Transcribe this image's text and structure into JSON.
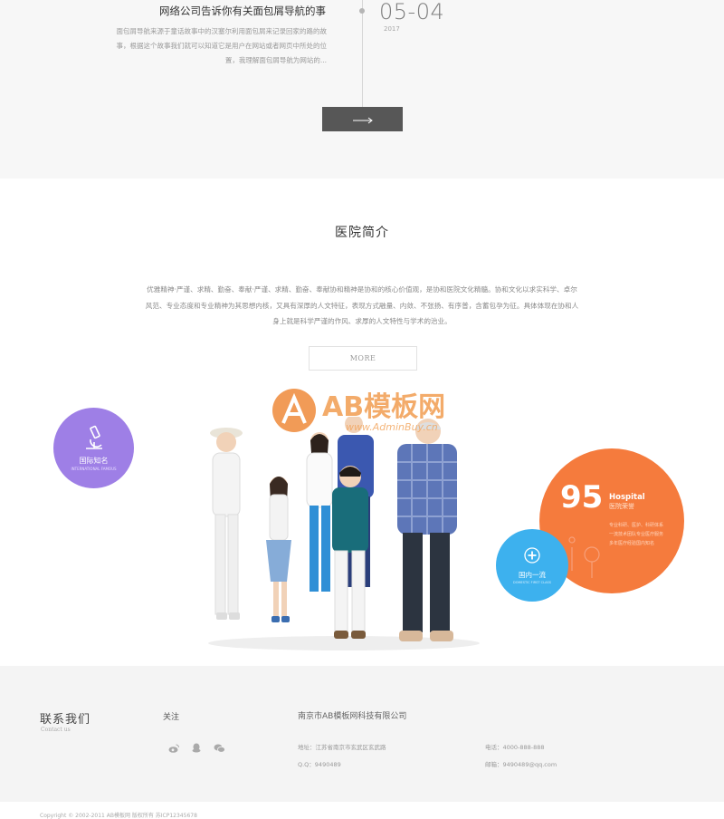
{
  "news": {
    "title": "网络公司告诉你有关面包屑导航的事",
    "description": "面包屑导航来源于童话故事中的汉塞尔利用面包屑来记录回家的路的故事，根据这个故事我们就可以知道它是用户在网站或者网页中所处的位置，我理解面包屑导航为网站的...",
    "date": "05-04",
    "year": "2017",
    "next_icon": "long-arrow-right-icon"
  },
  "intro": {
    "title": "医院简介",
    "text": "优雅精神·严谨、求精、勤奋、奉献·严谨、求精、勤奋、奉献协和精神是协和的核心价值观，是协和医院文化精髓。协和文化以求实科学、卓尔风范、专业态度和专业精神为其思想内核，又具有深厚的人文特征，表现方式融量、内敛、不张扬、有序普，含蓄包孕为征。具体体现在协和人身上就是科学严谨的作风、求厚的人文特性与学术的治业。",
    "more_label": "MORE"
  },
  "watermark": {
    "brand": "AB模板网",
    "url": "www.AdminBuy.cn"
  },
  "badges": {
    "purple": {
      "label": "国际知名",
      "sub": "INTERNATIONAL FAMOUS",
      "icon": "microscope-icon",
      "color": "#9e7fe6"
    },
    "orange": {
      "number": "95",
      "title_en": "Hospital",
      "title_cn": "医院荣誉",
      "lines": [
        "专业科研、医护、科研体系",
        "一流技术团队专业医疗服务",
        "多年医疗经验国内知名"
      ],
      "color": "#f57b3d"
    },
    "blue": {
      "label": "国内一流",
      "sub": "DOMESTIC FIRST CLASS",
      "icon": "medical-cross-icon",
      "color": "#3db1ee"
    }
  },
  "footer": {
    "contact_title": "联系我们",
    "contact_sub": "Contact us",
    "follow_title": "关注",
    "social_icons": [
      "weibo-icon",
      "qq-icon",
      "wechat-icon"
    ],
    "company_name": "南京市AB模板网科技有限公司",
    "address": "地址：江苏省南京市玄武区玄武路",
    "qq": "Q.Q：9490489",
    "phone": "电话：4000-888-888",
    "email": "邮箱：9490489@qq.com",
    "copyright": "Copyright © 2002-2011 AB模板网 版权所有   苏ICP12345678"
  }
}
